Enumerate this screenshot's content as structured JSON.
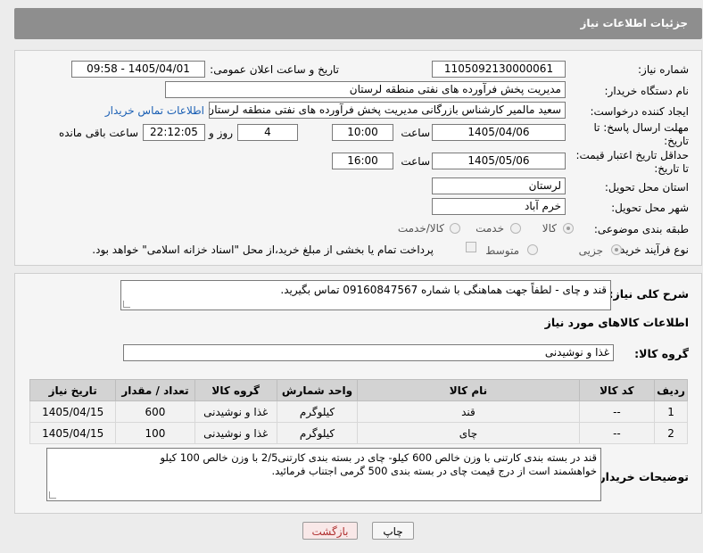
{
  "header": {
    "title": "جزئیات اطلاعات نیاز"
  },
  "form": {
    "need_number": {
      "label": "شماره نیاز:",
      "value": "1105092130000061"
    },
    "announce": {
      "label": "تاریخ و ساعت اعلان عمومی:",
      "value": "1405/04/01 - 09:58"
    },
    "buyer": {
      "label": "نام دستگاه خریدار:",
      "value": "مدیریت پخش فرآورده های نفتی منطقه لرستان"
    },
    "requester": {
      "label": "ایجاد کننده درخواست:",
      "value": "سعید مالمیر کارشناس بازرگانی مدیریت پخش فرآورده های نفتی منطقه لرستان",
      "link": "اطلاعات تماس خریدار"
    },
    "reply_deadline": {
      "label_line1": "مهلت ارسال پاسخ: تا",
      "label_line2": "تاریخ:",
      "date": "1405/04/06",
      "time_label": "ساعت",
      "time": "10:00",
      "days": "4",
      "days_label": "روز و",
      "remaining": "22:12:05",
      "remaining_label": "ساعت باقی مانده"
    },
    "price_validity": {
      "label_line1": "حداقل تاریخ اعتبار قیمت:",
      "label_line2": "تا تاریخ:",
      "date": "1405/05/06",
      "time_label": "ساعت",
      "time": "16:00"
    },
    "province": {
      "label": "استان محل تحویل:",
      "value": "لرستان"
    },
    "city": {
      "label": "شهر محل تحویل:",
      "value": "خرم آباد"
    },
    "category": {
      "label": "طبقه بندی موضوعی:",
      "options": [
        "کالا",
        "خدمت",
        "کالا/خدمت"
      ],
      "selected": "کالا"
    },
    "process": {
      "label": "نوع فرآیند خرید :",
      "options": [
        "جزیی",
        "متوسط"
      ],
      "selected": "جزیی",
      "payment_note": "پرداخت تمام یا بخشی از مبلغ خرید،از محل \"اسناد خزانه اسلامی\" خواهد بود."
    }
  },
  "summary": {
    "label": "شرح کلی نیاز:",
    "value": "قند و چای - لطفاً جهت هماهنگی با شماره 09160847567 تماس بگیرید."
  },
  "goods": {
    "section_title": "اطلاعات کالاهای مورد نیاز",
    "group_label": "گروه کالا:",
    "group_value": "غذا و نوشیدنی",
    "columns": [
      "ردیف",
      "کد کالا",
      "نام کالا",
      "واحد شمارش",
      "گروه کالا",
      "تعداد / مقدار",
      "تاریخ نیاز"
    ],
    "rows": [
      {
        "row": "1",
        "code": "--",
        "name": "قند",
        "unit": "کیلوگرم",
        "group": "غذا و نوشیدنی",
        "qty": "600",
        "date": "1405/04/15"
      },
      {
        "row": "2",
        "code": "--",
        "name": "چای",
        "unit": "کیلوگرم",
        "group": "غذا و نوشیدنی",
        "qty": "100",
        "date": "1405/04/15"
      }
    ]
  },
  "buyer_notes": {
    "label": "توضیحات خریدار:",
    "line1": "قند  در بسته بندی کارتنی با وزن خالص 600 کیلو- چای در بسته بندی کارتنی2/5 با وزن خالص 100 کیلو",
    "line2": "خواهشمند است از درج قیمت چای در بسته بندی 500 گرمی اجتناب فرمائید."
  },
  "buttons": {
    "print": "چاپ",
    "back": "بازگشت"
  }
}
